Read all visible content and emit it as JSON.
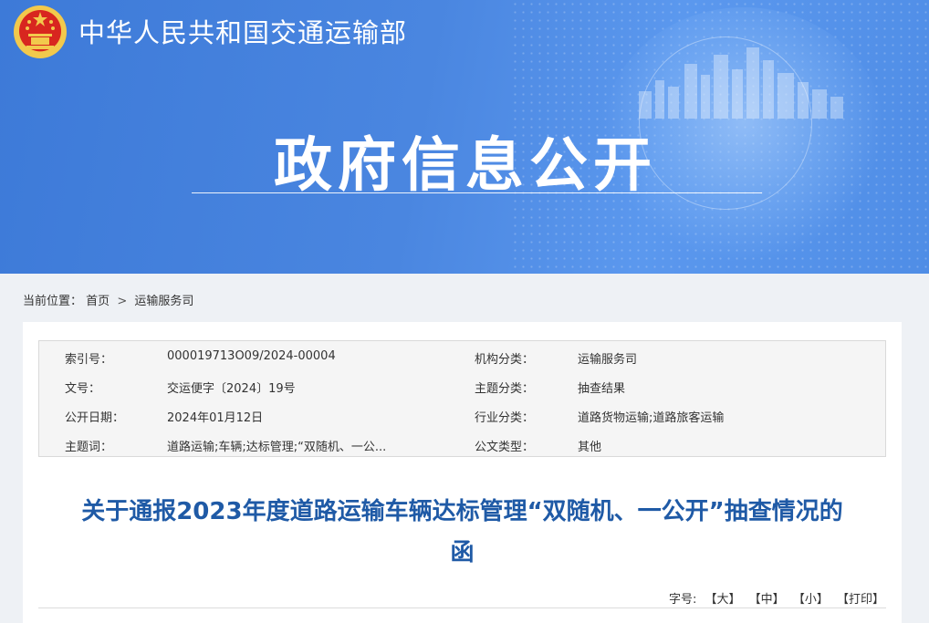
{
  "header": {
    "site_name": "中华人民共和国交通运输部",
    "banner_title": "政府信息公开",
    "emblem": "national-emblem-icon"
  },
  "breadcrumb": {
    "prefix": "当前位置：",
    "items": [
      "首页",
      "运输服务司"
    ],
    "separator": ">"
  },
  "meta": {
    "index_no_label": "索引号：",
    "index_no": "000019713O09/2024-00004",
    "agency_label": "机构分类：",
    "agency": "运输服务司",
    "doc_no_label": "文号：",
    "doc_no": "交运便字〔2024〕19号",
    "topic_label": "主题分类：",
    "topic": "抽查结果",
    "date_label": "公开日期：",
    "date": "2024年01月12日",
    "industry_label": "行业分类：",
    "industry": "道路货物运输;道路旅客运输",
    "keywords_label": "主题词：",
    "keywords": "道路运输;车辆;达标管理;“双随机、一公...",
    "doc_type_label": "公文类型：",
    "doc_type": "其他"
  },
  "article": {
    "title_line1": "关于通报2023年度道路运输车辆达标管理“双随机、一公开”抽查情况的",
    "title_line2": "函"
  },
  "font_bar": {
    "label": "字号:",
    "large": "【大】",
    "medium": "【中】",
    "small": "【小】",
    "print": "【打印】"
  },
  "colors": {
    "banner_blue": "#4a86e0",
    "title_blue": "#1f5aa6",
    "emblem_red": "#d8261f",
    "emblem_gold": "#f2c94c"
  }
}
